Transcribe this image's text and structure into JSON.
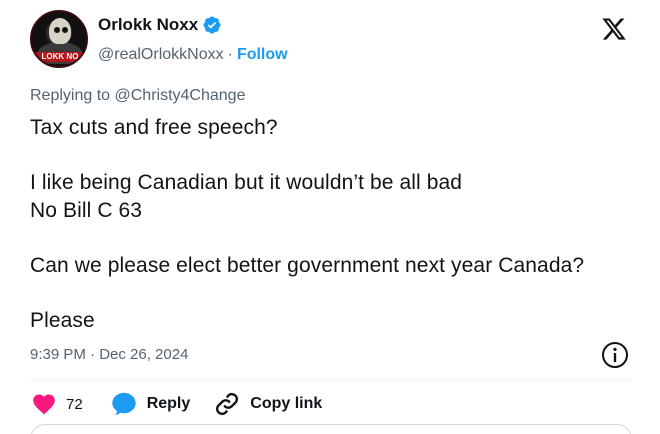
{
  "author": {
    "display_name": "Orlokk Noxx",
    "handle": "@realOrlokkNoxx",
    "separator": "·",
    "follow_label": "Follow",
    "avatar_banner": "LOKK NO",
    "verified_color": "#1d9bf0"
  },
  "tweet": {
    "replying_prefix": "Replying to",
    "replying_to": "@Christy4Change",
    "lines": [
      "Tax cuts and free speech?",
      "I like being Canadian but it wouldn’t be all bad",
      "No Bill C 63",
      "Can we please elect better government next year Canada?",
      "Please"
    ],
    "timestamp": "9:39 PM · Dec 26, 2024"
  },
  "actions": {
    "like_count": "72",
    "reply_label": "Reply",
    "copy_link_label": "Copy link",
    "like_color": "#f91880",
    "reply_color": "#1d9bf0"
  },
  "icons": [
    "verified-icon",
    "x-logo-icon",
    "info-icon",
    "heart-icon",
    "reply-bubble-icon",
    "link-icon"
  ]
}
